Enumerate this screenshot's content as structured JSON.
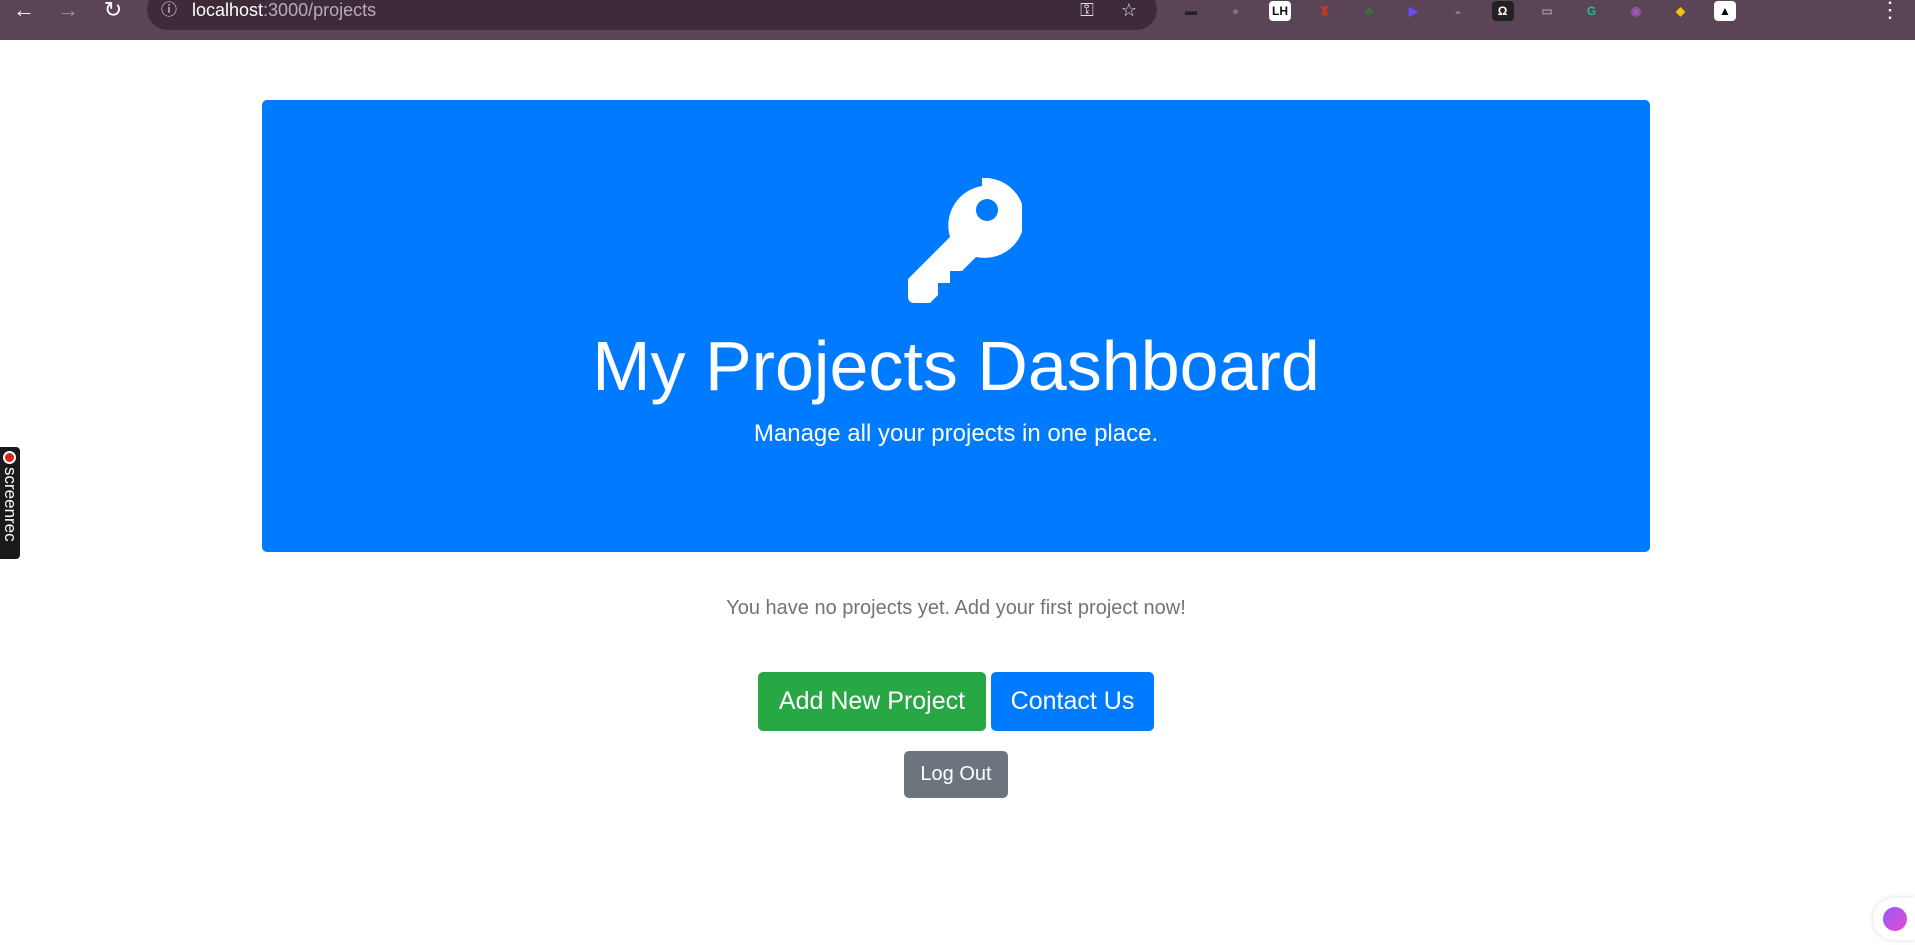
{
  "browser": {
    "url_host": "localhost",
    "url_path": ":3000/projects",
    "back_icon": "←",
    "forward_icon": "→",
    "reload_icon": "↻",
    "info_icon": "ⓘ",
    "password_icon": "⚿",
    "star_icon": "☆",
    "extensions": [
      {
        "name": "incognito-ext-icon",
        "glyph": "▬",
        "color": "#222"
      },
      {
        "name": "gray-ext-icon",
        "glyph": "●",
        "color": "#777"
      },
      {
        "name": "lh-ext-icon",
        "glyph": "LH",
        "color": "#111"
      },
      {
        "name": "red-ext-icon",
        "glyph": "♜",
        "color": "#c0392b"
      },
      {
        "name": "tree-ext-icon",
        "glyph": "♣",
        "color": "#2e7d32"
      },
      {
        "name": "play-ext-icon",
        "glyph": "▶",
        "color": "#6a4cff"
      },
      {
        "name": "bowl-ext-icon",
        "glyph": "◒",
        "color": "#888"
      },
      {
        "name": "omega-ext-icon",
        "glyph": "Ω",
        "color": "#fff"
      },
      {
        "name": "card-ext-icon",
        "glyph": "▭",
        "color": "#999"
      },
      {
        "name": "grammarly-ext-icon",
        "glyph": "G",
        "color": "#15c39a"
      },
      {
        "name": "brain-ext-icon",
        "glyph": "◉",
        "color": "#9b59b6"
      },
      {
        "name": "highlighter-ext-icon",
        "glyph": "◆",
        "color": "#f1c40f"
      },
      {
        "name": "triangle-ext-icon",
        "glyph": "▲",
        "color": "#000"
      },
      {
        "name": "puzzle-ext-icon",
        "glyph": "⧉",
        "color": "#5b4456"
      }
    ],
    "menu_icon": "⋮"
  },
  "hero": {
    "icon": "key-icon",
    "title": "My Projects Dashboard",
    "subtitle": "Manage all your projects in one place."
  },
  "main": {
    "empty_message": "You have no projects yet. Add your first project now!",
    "add_button": "Add New Project",
    "contact_button": "Contact Us",
    "logout_button": "Log Out"
  },
  "overlay": {
    "screenrec_label": "screenrec"
  },
  "colors": {
    "primary": "#007bff",
    "success": "#28a745",
    "secondary": "#6c757d",
    "browser_bar": "#5b4456"
  }
}
